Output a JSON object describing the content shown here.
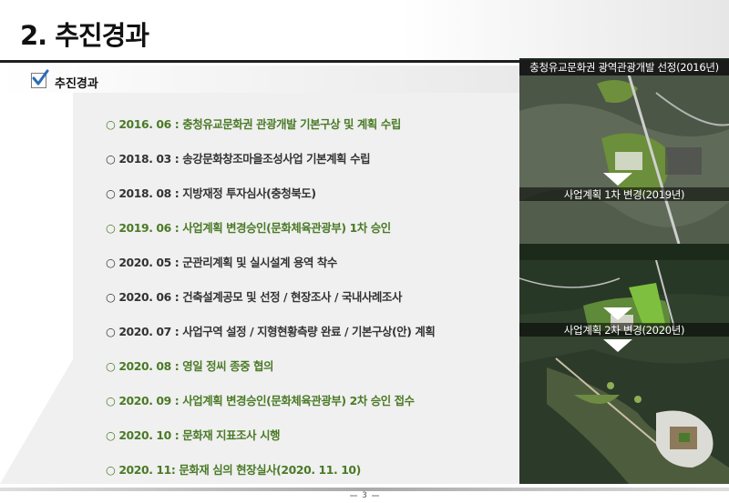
{
  "header": {
    "title": "2. 추진경과"
  },
  "section": {
    "title": "추진경과"
  },
  "timeline": [
    "○ 2016. 06 : 충청유교문화권 관광개발 기본구상 및 계획 수립",
    "○ 2018. 03 : 송강문화창조마을조성사업 기본계획 수립",
    "○ 2018. 08 : 지방재정 투자심사(충청북도)",
    "○ 2019. 06 : 사업계획 변경승인(문화체육관광부) 1차 승인",
    "○ 2020. 05 : 군관리계획 및 실시설계 용역 착수",
    "○ 2020. 06 : 건축설계공모 및 선정 / 현장조사 / 국내사례조사",
    "○ 2020. 07 :  사업구역 설정 / 지형현황측량 완료 / 기본구상(안) 계획",
    "○ 2020. 08 : 영일 정씨 종중 협의",
    "○ 2020. 09 : 사업계획 변경승인(문화체육관광부) 2차 승인 접수",
    "○ 2020. 10 : 문화재 지표조사 시행",
    "○ 2020. 11: 문화재 심의 현장실사(2020. 11. 10)"
  ],
  "maps": {
    "caption1": "충청유교문화권 광역관광개발 선정(2016년)",
    "caption2": "사업계획 1차 변경(2019년)",
    "caption3": "사업계획 2차 변경(2020년)"
  },
  "footer": {
    "page_number": "3"
  },
  "colors": {
    "highlight": "#4a7a26",
    "normal": "#333333",
    "check": "#2a6db5"
  },
  "icons": {
    "checkbox": "checkbox-checked-icon",
    "arrow": "arrow-down-icon"
  }
}
